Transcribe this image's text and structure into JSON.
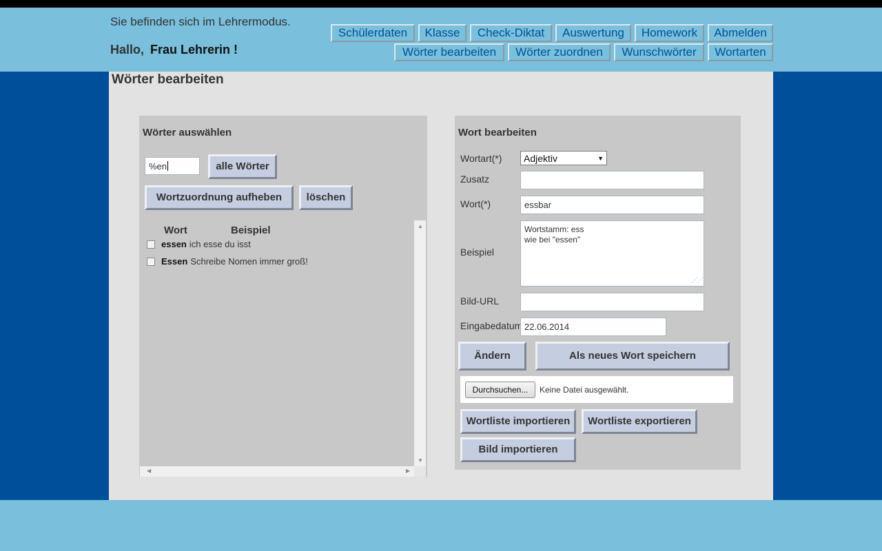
{
  "header": {
    "mode_text": "Sie befinden sich im Lehrermodus.",
    "greeting": "Hallo,",
    "user_name": "Frau Lehrerin !",
    "nav_row1": [
      "Schülerdaten",
      "Klasse",
      "Check-Diktat",
      "Auswertung",
      "Homework",
      "Abmelden"
    ],
    "nav_row2": [
      "Wörter bearbeiten",
      "Wörter zuordnen",
      "Wunschwörter",
      "Wortarten"
    ]
  },
  "page_title": "Wörter bearbeiten",
  "left_panel": {
    "title": "Wörter auswählen",
    "search_value": "%en",
    "all_words_button": "alle Wörter",
    "remove_assignment_button": "Wortzuordnung aufheben",
    "delete_button": "löschen",
    "columns": [
      "Wort",
      "Beispiel"
    ],
    "words": [
      {
        "word": "essen",
        "example": "ich esse du isst",
        "checked": false
      },
      {
        "word": "Essen",
        "example": "Schreibe Nomen immer groß!",
        "checked": false
      }
    ]
  },
  "right_panel": {
    "title": "Wort bearbeiten",
    "labels": {
      "wortart": "Wortart(*)",
      "zusatz": "Zusatz",
      "wort": "Wort(*)",
      "beispiel": "Beispiel",
      "bild_url": "Bild-URL",
      "eingabedatum": "Eingabedatum"
    },
    "values": {
      "wortart": "Adjektiv",
      "zusatz": "",
      "wort": "essbar",
      "beispiel_line1": "Wortstamm: ess",
      "beispiel_line2": "wie bei \"essen\"",
      "bild_url": "",
      "eingabedatum": "22.06.2014"
    },
    "buttons": {
      "change": "Ändern",
      "save_new": "Als neues Wort speichern",
      "browse": "Durchsuchen...",
      "file_status": "Keine Datei ausgewählt.",
      "import_list": "Wortliste importieren",
      "export_list": "Wortliste exportieren",
      "import_image": "Bild importieren"
    }
  }
}
